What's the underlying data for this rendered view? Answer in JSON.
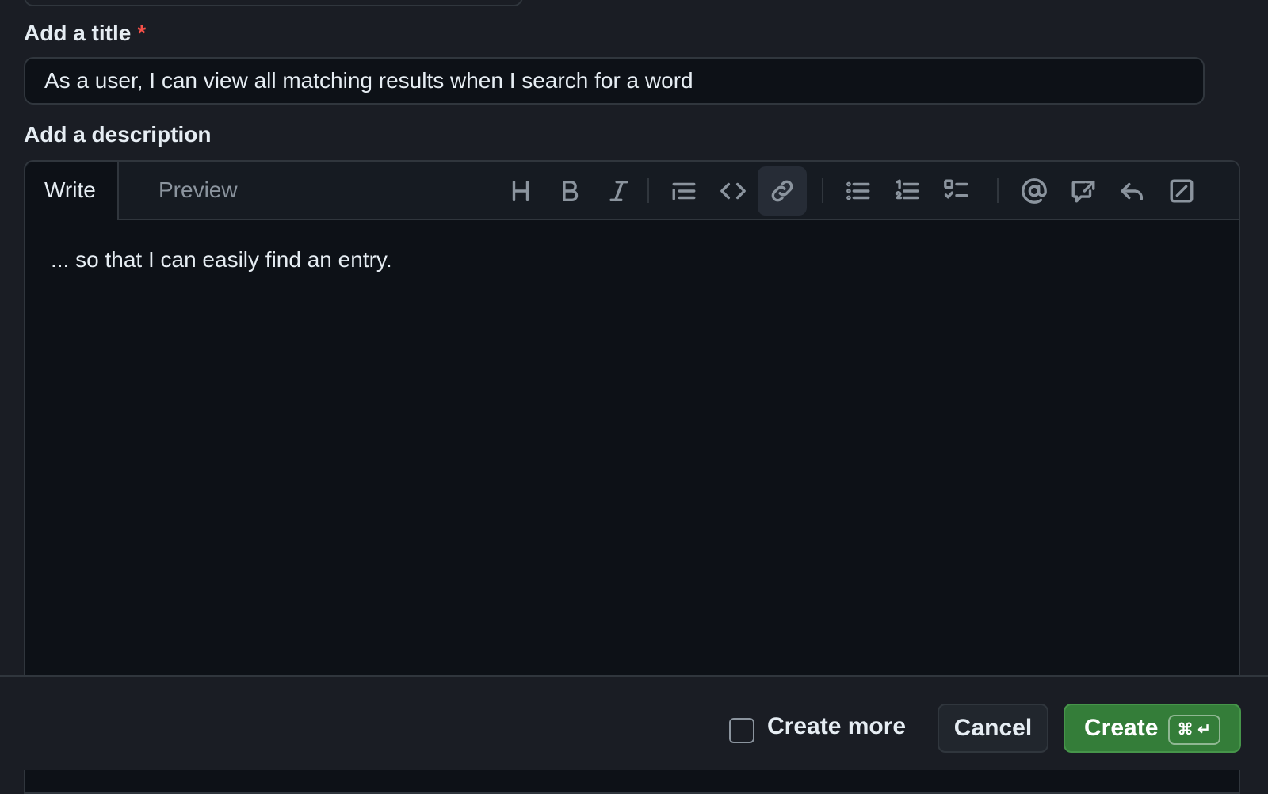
{
  "title_section": {
    "label": "Add a title",
    "required_mark": "*",
    "value": "As a user, I can view all matching results when I search for a word"
  },
  "description_section": {
    "label": "Add a description",
    "tabs": [
      "Write",
      "Preview"
    ],
    "active_tab": "Write",
    "toolbar": [
      "heading-icon",
      "bold-icon",
      "italic-icon",
      "quote-icon",
      "code-icon",
      "link-icon",
      "unordered-list-icon",
      "ordered-list-icon",
      "task-list-icon",
      "mention-icon",
      "cross-reference-icon",
      "reply-icon",
      "slash-command-icon"
    ],
    "active_tool": "link-icon",
    "body": "... so that I can easily find an entry."
  },
  "footer": {
    "create_more_label": "Create more",
    "create_more_checked": false,
    "cancel_label": "Cancel",
    "create_label": "Create",
    "create_shortcut": "⌘ ↵"
  },
  "colors": {
    "accent_green": "#347d39",
    "required_red": "#f85149"
  }
}
